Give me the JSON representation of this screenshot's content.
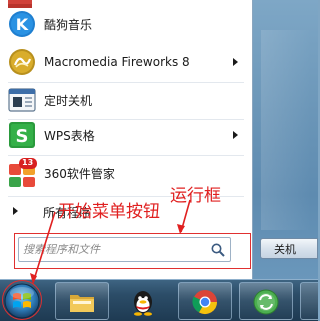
{
  "menu": {
    "items": [
      {
        "label": "酷狗音乐",
        "icon": "kugou-icon",
        "has_submenu": false
      },
      {
        "label": "Macromedia Fireworks 8",
        "icon": "fireworks-icon",
        "has_submenu": true
      },
      {
        "label": "定时关机",
        "icon": "timer-shutdown-icon",
        "has_submenu": false
      },
      {
        "label": "WPS表格",
        "icon": "wps-spreadsheet-icon",
        "has_submenu": true
      },
      {
        "label": "360软件管家",
        "icon": "360-software-manager-icon",
        "has_submenu": false,
        "badge": "13"
      }
    ],
    "all_programs": "所有程序"
  },
  "search": {
    "placeholder": "搜索程序和文件"
  },
  "shutdown": {
    "label": "关机"
  },
  "annotations": {
    "start_menu_button": "开始菜单按钮",
    "run_box": "运行框",
    "color": "#e02020"
  },
  "taskbar": {
    "items": [
      {
        "icon": "start-orb-icon"
      },
      {
        "icon": "folder-icon"
      },
      {
        "icon": "qq-icon"
      },
      {
        "icon": "chrome-icon"
      },
      {
        "icon": "sync-icon"
      }
    ]
  }
}
